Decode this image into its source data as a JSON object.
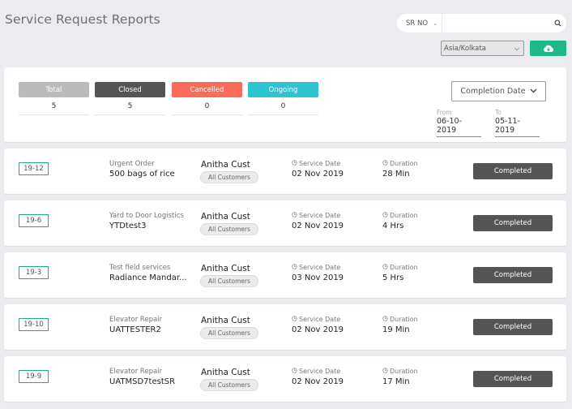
{
  "page": {
    "title": "Service Request Reports"
  },
  "search": {
    "filter_label": "SR NO",
    "value": "",
    "placeholder": ""
  },
  "timezone": {
    "selected": "Asia/Kolkata"
  },
  "summary": {
    "stats": [
      {
        "label": "Total",
        "value": "5",
        "color": "#bbbbbb"
      },
      {
        "label": "Closed",
        "value": "5",
        "color": "#555555"
      },
      {
        "label": "Cancelled",
        "value": "0",
        "color": "#fb6c58"
      },
      {
        "label": "Ongoing",
        "value": "0",
        "color": "#2ec3d1"
      }
    ],
    "date_filter_label": "Completion Date",
    "from_label": "From",
    "from_value": "06-10-2019",
    "to_label": "To",
    "to_value": "05-11-2019"
  },
  "labels": {
    "service_date": "Service Date",
    "duration": "Duration"
  },
  "requests": [
    {
      "id": "19-12",
      "type": "Urgent Order",
      "name": "500 bags of rice",
      "customer": "Anitha Cust",
      "group": "All Customers",
      "service_date": "02 Nov 2019",
      "duration": "28 Min",
      "status": "Completed"
    },
    {
      "id": "19-6",
      "type": "Yard to Door Logistics",
      "name": "YTDtest3",
      "customer": "Anitha Cust",
      "group": "All Customers",
      "service_date": "02 Nov 2019",
      "duration": "4 Hrs",
      "status": "Completed"
    },
    {
      "id": "19-3",
      "type": "Test field services",
      "name": "Radiance Mandar...",
      "customer": "Anitha Cust",
      "group": "All Customers",
      "service_date": "03 Nov 2019",
      "duration": "5 Hrs",
      "status": "Completed"
    },
    {
      "id": "19-10",
      "type": "Elevator Repair",
      "name": "UATTESTER2",
      "customer": "Anitha Cust",
      "group": "All Customers",
      "service_date": "02 Nov 2019",
      "duration": "19 Min",
      "status": "Completed"
    },
    {
      "id": "19-9",
      "type": "Elevator Repair",
      "name": "UATMSD7testSR",
      "customer": "Anitha Cust",
      "group": "All Customers",
      "service_date": "02 Nov 2019",
      "duration": "17 Min",
      "status": "Completed"
    }
  ]
}
